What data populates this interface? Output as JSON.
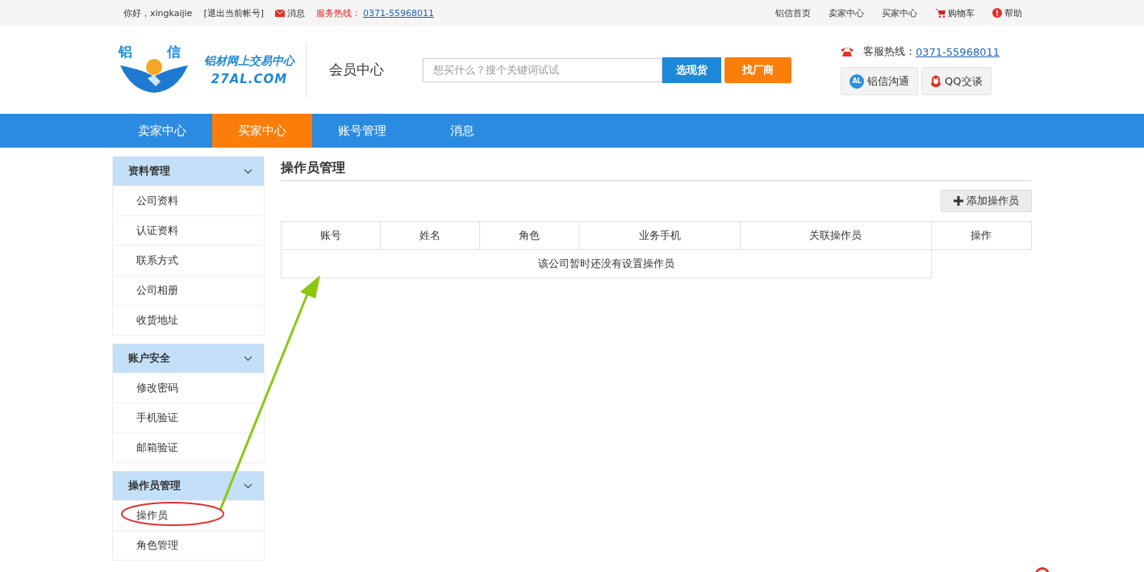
{
  "top_bar": {
    "greeting": "你好，xingkaijie",
    "logout": "[退出当前帐号]",
    "messages": "消息",
    "hotline_label": "服务热线：",
    "hotline_number": "0371-55968011",
    "links": [
      {
        "label": "铝信首页",
        "kind": "plain"
      },
      {
        "label": "卖家中心",
        "kind": "plain"
      },
      {
        "label": "买家中心",
        "kind": "plain"
      },
      {
        "label": "购物车",
        "kind": "cart"
      },
      {
        "label": "帮助",
        "kind": "help"
      }
    ]
  },
  "header": {
    "logo": {
      "chars": [
        "铝",
        "信"
      ],
      "slogan": "铝材网上交易中心",
      "domain": "27AL.COM"
    },
    "title": "会员中心",
    "search": {
      "placeholder": "想买什么？搜个关键词试试"
    },
    "search_buttons": [
      {
        "label": "选现货",
        "kind": "primary"
      },
      {
        "label": "找厂商",
        "kind": "accent"
      }
    ],
    "contact": {
      "label": "客服热线：",
      "number": "0371-55968011"
    },
    "chat_buttons": [
      {
        "label": "铝信沟通",
        "kind": "al",
        "icon_text": "AL"
      },
      {
        "label": "QQ交谈",
        "kind": "qq"
      }
    ]
  },
  "nav": [
    {
      "label": "卖家中心",
      "selected": false
    },
    {
      "label": "买家中心",
      "selected": true
    },
    {
      "label": "账号管理",
      "selected": false
    },
    {
      "label": "消息",
      "selected": false
    }
  ],
  "sidebar": [
    {
      "title": "资料管理",
      "expanded": true,
      "items": [
        {
          "label": "公司资料",
          "selected": false
        },
        {
          "label": "认证资料",
          "selected": false
        },
        {
          "label": "联系方式",
          "selected": false
        },
        {
          "label": "公司相册",
          "selected": false
        },
        {
          "label": "收货地址",
          "selected": false
        }
      ]
    },
    {
      "title": "账户安全",
      "expanded": true,
      "items": [
        {
          "label": "修改密码",
          "selected": false
        },
        {
          "label": "手机验证",
          "selected": false
        },
        {
          "label": "邮箱验证",
          "selected": false
        }
      ]
    },
    {
      "title": "操作员管理",
      "expanded": true,
      "items": [
        {
          "label": "操作员",
          "selected": false
        },
        {
          "label": "角色管理",
          "selected": false
        }
      ]
    }
  ],
  "content": {
    "title": "操作员管理",
    "add_button": "添加操作员",
    "table": {
      "columns": [
        "账号",
        "姓名",
        "角色",
        "业务手机",
        "关联操作员",
        "操作"
      ],
      "empty_message": "该公司暂时还没有设置操作员"
    }
  }
}
